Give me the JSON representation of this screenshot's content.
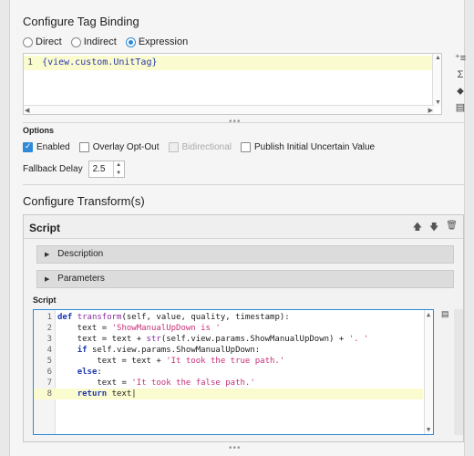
{
  "binding": {
    "title": "Configure Tag Binding",
    "radios": [
      {
        "label": "Direct",
        "selected": false
      },
      {
        "label": "Indirect",
        "selected": false
      },
      {
        "label": "Expression",
        "selected": true
      }
    ],
    "expression": {
      "line_number": "1",
      "code": "{view.custom.UnitTag}"
    },
    "side_icons": [
      "add-format-icon",
      "sigma-icon",
      "tag-icon",
      "list-icon"
    ]
  },
  "options": {
    "title": "Options",
    "checkboxes": [
      {
        "label": "Enabled",
        "checked": true,
        "disabled": false
      },
      {
        "label": "Overlay Opt-Out",
        "checked": false,
        "disabled": false
      },
      {
        "label": "Bidirectional",
        "checked": false,
        "disabled": true
      },
      {
        "label": "Publish Initial Uncertain Value",
        "checked": false,
        "disabled": false
      }
    ],
    "fallback_label": "Fallback Delay",
    "fallback_value": "2.5"
  },
  "transforms": {
    "title": "Configure Transform(s)",
    "card_title": "Script",
    "description_label": "Description",
    "parameters_label": "Parameters",
    "script_label": "Script"
  },
  "code_lines": [
    {
      "n": "1",
      "text": "def transform(self, value, quality, timestamp):"
    },
    {
      "n": "2",
      "text": "    text = 'ShowManualUpDown is '"
    },
    {
      "n": "3",
      "text": "    text = text + str(self.view.params.ShowManualUpDown) + '. '"
    },
    {
      "n": "4",
      "text": "    if self.view.params.ShowManualUpDown:"
    },
    {
      "n": "5",
      "text": "        text = text + 'It took the true path.'"
    },
    {
      "n": "6",
      "text": "    else:"
    },
    {
      "n": "7",
      "text": "        text = 'It took the false path.'"
    },
    {
      "n": "8",
      "text": "    return text"
    }
  ]
}
